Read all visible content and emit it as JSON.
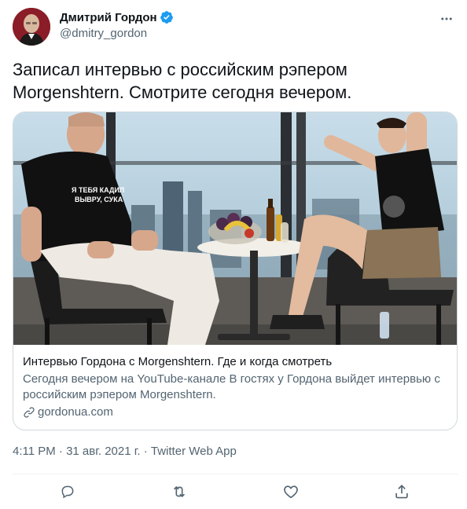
{
  "author": {
    "name": "Дмитрий Гордон",
    "handle": "@dmitry_gordon"
  },
  "tweet": {
    "text": "Записал интервью с российским рэпером Morgenshtern. Смотрите сегодня вечером."
  },
  "card": {
    "title": "Интервью Гордона с Morgenshtern. Где и когда смотреть",
    "description": "Сегодня вечером на YouTube-канале В гостях у Гордона выйдет интервью с российским рэпером Morgenshtern.",
    "domain": "gordonua.com",
    "tshirt_text_left": "Я ТЕБЯ КАДИЛ ВЫВРУ, СУКА"
  },
  "meta": {
    "timestamp": "4:11 PM · 31 авг. 2021 г. · Twitter Web App"
  },
  "icons": {
    "verified": "verified-badge-icon",
    "more": "more-dots-icon",
    "link": "link-icon",
    "reply": "reply-icon",
    "retweet": "retweet-icon",
    "like": "heart-icon",
    "share": "share-icon"
  },
  "colors": {
    "accent": "#1d9bf0",
    "text": "#0f1419",
    "secondary": "#536471",
    "border": "#cfd9de"
  }
}
